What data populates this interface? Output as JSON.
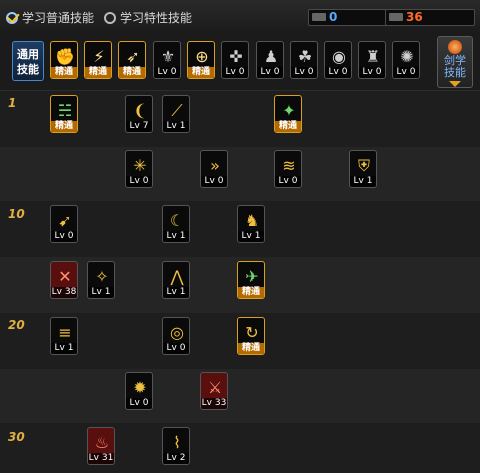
{
  "header": {
    "tab_normal": "学习普通技能",
    "tab_special": "学习特性技能",
    "sp_normal_value": "0",
    "sp_special_value": "36",
    "sp_normal_color": "#55aaff",
    "sp_special_color": "#ff6a2a"
  },
  "common": {
    "label": "通用技能",
    "book_label": "剑学技能",
    "skills": [
      {
        "icon": "fist-icon",
        "glyph": "✊",
        "tag": "精通",
        "state": "master"
      },
      {
        "icon": "dash-icon",
        "glyph": "⚡",
        "tag": "精通",
        "state": "master"
      },
      {
        "icon": "runner-icon",
        "glyph": "➶",
        "tag": "精通",
        "state": "master"
      },
      {
        "icon": "wings-icon",
        "glyph": "⚜",
        "tag": "Lv 0",
        "state": "normal"
      },
      {
        "icon": "target-icon",
        "glyph": "⊕",
        "tag": "精通",
        "state": "master"
      },
      {
        "icon": "crosshair-icon",
        "glyph": "✜",
        "tag": "Lv 0",
        "state": "normal"
      },
      {
        "icon": "figure-icon",
        "glyph": "♟",
        "tag": "Lv 0",
        "state": "normal"
      },
      {
        "icon": "leaf-icon",
        "glyph": "☘",
        "tag": "Lv 0",
        "state": "normal"
      },
      {
        "icon": "eye-icon",
        "glyph": "◉",
        "tag": "Lv 0",
        "state": "normal"
      },
      {
        "icon": "muscle-icon",
        "glyph": "♜",
        "tag": "Lv 0",
        "state": "normal"
      },
      {
        "icon": "swirl-icon",
        "glyph": "✺",
        "tag": "Lv 0",
        "state": "normal"
      }
    ]
  },
  "levels": [
    {
      "label": "1"
    },
    {
      "label": "10"
    },
    {
      "label": "20"
    },
    {
      "label": "30"
    }
  ],
  "tree": [
    {
      "icon": "claw-icon",
      "glyph": "☵",
      "tag": "精通",
      "state": "master",
      "color": "c-green"
    },
    {
      "icon": "slash-icon",
      "glyph": "❨",
      "tag": "Lv 7",
      "state": "normal",
      "color": "c-gold"
    },
    {
      "icon": "sweep-icon",
      "glyph": "⟋",
      "tag": "Lv 1",
      "state": "normal",
      "color": "c-gold"
    },
    {
      "icon": "leap-icon",
      "glyph": "✦",
      "tag": "精通",
      "state": "master",
      "color": "c-green"
    },
    {
      "icon": "burst-icon",
      "glyph": "✳",
      "tag": "Lv 0",
      "state": "normal",
      "color": "c-gold"
    },
    {
      "icon": "arrows-icon",
      "glyph": "»",
      "tag": "Lv 0",
      "state": "normal",
      "color": "c-gold"
    },
    {
      "icon": "wave-icon",
      "glyph": "≋",
      "tag": "Lv 0",
      "state": "normal",
      "color": "c-gold"
    },
    {
      "icon": "shield-icon",
      "glyph": "⛨",
      "tag": "Lv 1",
      "state": "normal",
      "color": "c-gold"
    },
    {
      "icon": "wing-slash-icon",
      "glyph": "➹",
      "tag": "Lv 0",
      "state": "normal",
      "color": "c-gold"
    },
    {
      "icon": "crescent-icon",
      "glyph": "☾",
      "tag": "Lv 1",
      "state": "normal",
      "color": "c-gold"
    },
    {
      "icon": "warrior-icon",
      "glyph": "♞",
      "tag": "Lv 1",
      "state": "normal",
      "color": "c-gold"
    },
    {
      "icon": "blood-strike-icon",
      "glyph": "✕",
      "tag": "Lv 38",
      "state": "normal",
      "color": "c-red"
    },
    {
      "icon": "whirl-icon",
      "glyph": "✧",
      "tag": "Lv 1",
      "state": "normal",
      "color": "c-gold"
    },
    {
      "icon": "triangle-icon",
      "glyph": "⋀",
      "tag": "Lv 1",
      "state": "normal",
      "color": "c-gold"
    },
    {
      "icon": "blade-icon",
      "glyph": "✈",
      "tag": "精通",
      "state": "master",
      "color": "c-green"
    },
    {
      "icon": "flurry-icon",
      "glyph": "≡",
      "tag": "Lv 1",
      "state": "normal",
      "color": "c-gold"
    },
    {
      "icon": "ring-icon",
      "glyph": "◎",
      "tag": "Lv 0",
      "state": "normal",
      "color": "c-gold"
    },
    {
      "icon": "cycle-icon",
      "glyph": "↻",
      "tag": "精通",
      "state": "master",
      "color": "c-gold"
    },
    {
      "icon": "star-burst-icon",
      "glyph": "✹",
      "tag": "Lv 0",
      "state": "normal",
      "color": "c-gold"
    },
    {
      "icon": "fire-strike-icon",
      "glyph": "⚔",
      "tag": "Lv 33",
      "state": "normal",
      "color": "c-red"
    },
    {
      "icon": "rage-icon",
      "glyph": "♨",
      "tag": "Lv 31",
      "state": "normal",
      "color": "c-red"
    },
    {
      "icon": "tornado-icon",
      "glyph": "⌇",
      "tag": "Lv 2",
      "state": "normal",
      "color": "c-gold"
    }
  ]
}
